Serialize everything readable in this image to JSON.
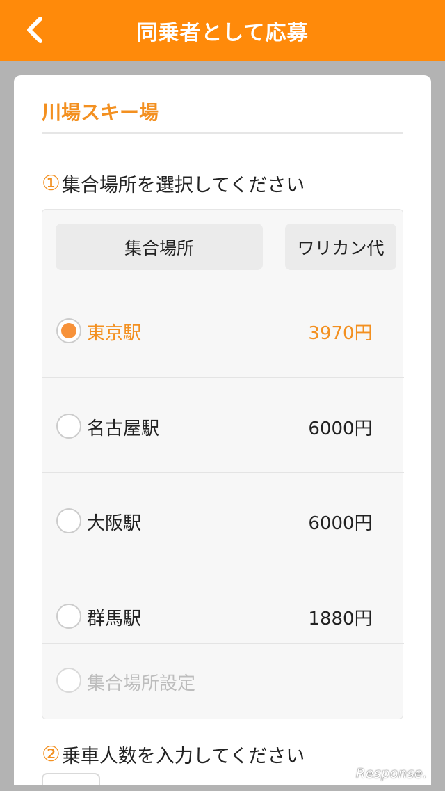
{
  "header": {
    "title": "同乗者として応募",
    "back_icon": "chevron-left-icon"
  },
  "card": {
    "resort_name": "川場スキー場"
  },
  "section1": {
    "num": "①",
    "heading": "集合場所を選択してください"
  },
  "table": {
    "col_location": "集合場所",
    "col_fare": "ワリカン代",
    "rows": [
      {
        "station": "東京駅",
        "price": "3970円",
        "selected": true
      },
      {
        "station": "名古屋駅",
        "price": "6000円",
        "selected": false
      },
      {
        "station": "大阪駅",
        "price": "6000円",
        "selected": false
      },
      {
        "station": "群馬駅",
        "price": "1880円",
        "selected": false
      }
    ],
    "custom_option": "集合場所設定"
  },
  "section2": {
    "num": "②",
    "heading": "乗車人数を入力してください"
  },
  "watermark": "Response.",
  "colors": {
    "accent": "#ff8a0a",
    "selected_text": "#f39020",
    "background": "#b3b3b3"
  }
}
